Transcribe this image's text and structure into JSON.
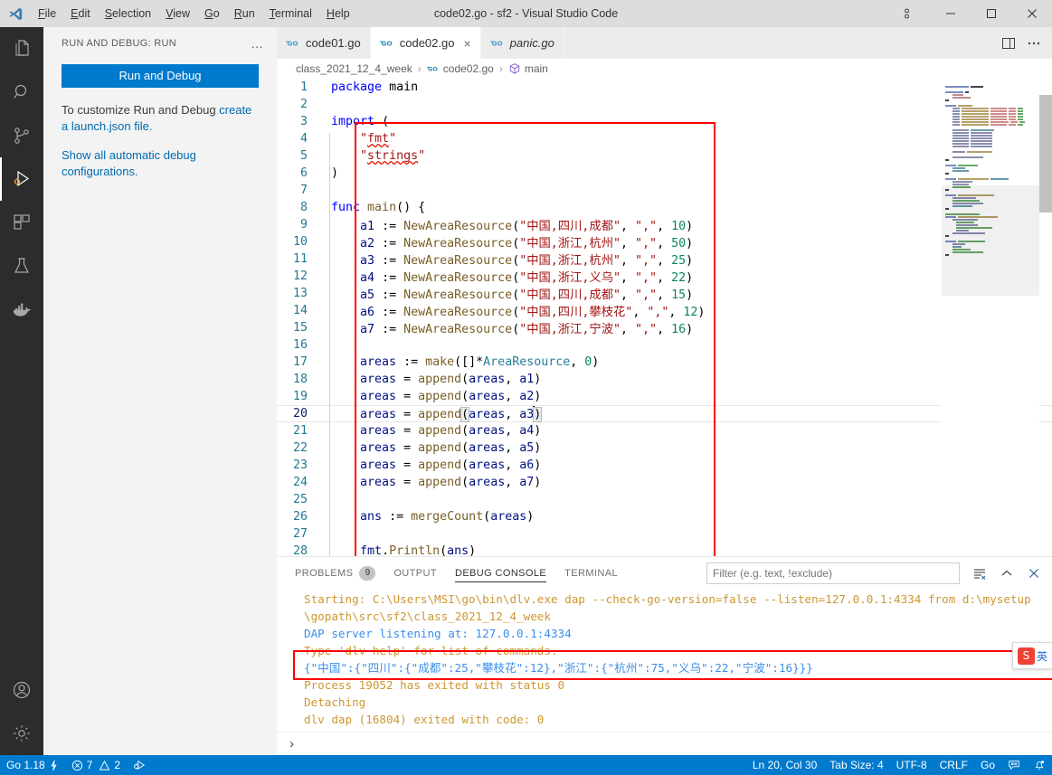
{
  "window": {
    "title": "code02.go - sf2 - Visual Studio Code",
    "menu": [
      "File",
      "Edit",
      "Selection",
      "View",
      "Go",
      "Run",
      "Terminal",
      "Help"
    ],
    "controls": {
      "layout": "editor-layout-icon",
      "minimize": "minimize-icon",
      "maximize": "maximize-icon",
      "close": "close-icon"
    }
  },
  "activitybar": {
    "items": [
      {
        "name": "explorer",
        "icon": "files-icon",
        "active": false
      },
      {
        "name": "search",
        "icon": "search-icon",
        "active": false
      },
      {
        "name": "source-control",
        "icon": "source-control-icon",
        "active": false
      },
      {
        "name": "run-and-debug",
        "icon": "run-debug-icon",
        "active": true
      },
      {
        "name": "extensions",
        "icon": "extensions-icon",
        "active": false
      },
      {
        "name": "testing",
        "icon": "beaker-icon",
        "active": false
      },
      {
        "name": "docker",
        "icon": "docker-icon",
        "active": false
      },
      {
        "name": "accounts",
        "icon": "account-icon",
        "active": false
      },
      {
        "name": "settings",
        "icon": "gear-icon",
        "active": false
      }
    ]
  },
  "sidebar": {
    "header": "RUN AND DEBUG: RUN",
    "more_actions": "…",
    "run_button": "Run and Debug",
    "customize_text_lead": "To customize Run and Debug ",
    "customize_link": "create a launch.json file.",
    "automatic_link": "Show all automatic debug configurations."
  },
  "tabs": [
    {
      "label": "code01.go",
      "icon": "go-file-icon",
      "active": false,
      "preview": false,
      "dirty": false
    },
    {
      "label": "code02.go",
      "icon": "go-file-icon",
      "active": true,
      "preview": false,
      "close": "×"
    },
    {
      "label": "panic.go",
      "icon": "go-file-icon",
      "active": false,
      "preview": true
    }
  ],
  "editor_actions": {
    "split": "split-editor-icon",
    "more": "more-actions-icon"
  },
  "breadcrumb": [
    {
      "label": "class_2021_12_4_week",
      "icon": ""
    },
    {
      "label": "code02.go",
      "icon": "go-file-icon"
    },
    {
      "label": "main",
      "icon": "symbol-method-icon"
    }
  ],
  "breadcrumb_separator": "›",
  "code": {
    "language": "go",
    "lines": [
      {
        "n": 1,
        "text": "package main"
      },
      {
        "n": 2,
        "text": ""
      },
      {
        "n": 3,
        "text": "import ("
      },
      {
        "n": 4,
        "text": "    \"fmt\""
      },
      {
        "n": 5,
        "text": "    \"strings\""
      },
      {
        "n": 6,
        "text": ")"
      },
      {
        "n": 7,
        "text": ""
      },
      {
        "n": 8,
        "text": "func main() {"
      },
      {
        "n": 9,
        "text": "    a1 := NewAreaResource(\"中国,四川,成都\", \",\", 10)"
      },
      {
        "n": 10,
        "text": "    a2 := NewAreaResource(\"中国,浙江,杭州\", \",\", 50)"
      },
      {
        "n": 11,
        "text": "    a3 := NewAreaResource(\"中国,浙江,杭州\", \",\", 25)"
      },
      {
        "n": 12,
        "text": "    a4 := NewAreaResource(\"中国,浙江,义乌\", \",\", 22)"
      },
      {
        "n": 13,
        "text": "    a5 := NewAreaResource(\"中国,四川,成都\", \",\", 15)"
      },
      {
        "n": 14,
        "text": "    a6 := NewAreaResource(\"中国,四川,攀枝花\", \",\", 12)"
      },
      {
        "n": 15,
        "text": "    a7 := NewAreaResource(\"中国,浙江,宁波\", \",\", 16)"
      },
      {
        "n": 16,
        "text": ""
      },
      {
        "n": 17,
        "text": "    areas := make([]*AreaResource, 0)"
      },
      {
        "n": 18,
        "text": "    areas = append(areas, a1)"
      },
      {
        "n": 19,
        "text": "    areas = append(areas, a2)"
      },
      {
        "n": 20,
        "text": "    areas = append(areas, a3)"
      },
      {
        "n": 21,
        "text": "    areas = append(areas, a4)"
      },
      {
        "n": 22,
        "text": "    areas = append(areas, a5)"
      },
      {
        "n": 23,
        "text": "    areas = append(areas, a6)"
      },
      {
        "n": 24,
        "text": "    areas = append(areas, a7)"
      },
      {
        "n": 25,
        "text": ""
      },
      {
        "n": 26,
        "text": "    ans := mergeCount(areas)"
      },
      {
        "n": 27,
        "text": ""
      },
      {
        "n": 28,
        "text": "    fmt.Println(ans)"
      }
    ],
    "current_line": 20,
    "unused_import": "strings"
  },
  "annotation": {
    "color": "#ff0000",
    "code_box_label": "code-highlight-box",
    "console_box_label": "console-highlight-box"
  },
  "panel": {
    "tabs": [
      {
        "label": "PROBLEMS",
        "badge": "9",
        "active": false
      },
      {
        "label": "OUTPUT",
        "badge": "",
        "active": false
      },
      {
        "label": "DEBUG CONSOLE",
        "badge": "",
        "active": true
      },
      {
        "label": "TERMINAL",
        "badge": "",
        "active": false
      }
    ],
    "filter_placeholder": "Filter (e.g. text, !exclude)",
    "filter_value": "",
    "actions": {
      "clear": "clear-console-icon",
      "maximize": "chevron-up-icon",
      "close": "close-panel-icon"
    },
    "console_lines": [
      {
        "text": "Starting: C:\\Users\\MSI\\go\\bin\\dlv.exe dap --check-go-version=false --listen=127.0.0.1:4334 from d:\\mysetup",
        "color": "orange"
      },
      {
        "text": "\\gopath\\src\\sf2\\class_2021_12_4_week",
        "color": "orange"
      },
      {
        "text": "DAP server listening at: 127.0.0.1:4334",
        "color": "blue"
      },
      {
        "text": "Type 'dlv help' for list of commands.",
        "color": "orange"
      },
      {
        "text": "{\"中国\":{\"四川\":{\"成都\":25,\"攀枝花\":12},\"浙江\":{\"杭州\":75,\"义乌\":22,\"宁波\":16}}}",
        "color": "blue"
      },
      {
        "text": "Process 19052 has exited with status 0",
        "color": "orange"
      },
      {
        "text": "Detaching",
        "color": "orange"
      },
      {
        "text": "dlv dap (16804) exited with code: 0",
        "color": "orange"
      }
    ],
    "prompt": "›"
  },
  "statusbar": {
    "left": [
      {
        "name": "go-version",
        "label": "Go 1.18",
        "icon": "lightning-icon"
      },
      {
        "name": "problems",
        "label": "7",
        "label2": "2",
        "icon": "error-icon",
        "icon2": "warning-icon"
      },
      {
        "name": "run-task",
        "label": "",
        "icon": "debug-alt-icon"
      }
    ],
    "right": [
      {
        "name": "cursor-position",
        "label": "Ln 20, Col 30"
      },
      {
        "name": "tab-size",
        "label": "Tab Size: 4"
      },
      {
        "name": "encoding",
        "label": "UTF-8"
      },
      {
        "name": "eol",
        "label": "CRLF"
      },
      {
        "name": "language-mode",
        "label": "Go"
      },
      {
        "name": "feedback",
        "label": "",
        "icon": "feedback-icon"
      },
      {
        "name": "notifications",
        "label": "",
        "icon": "bell-dot-icon"
      }
    ]
  },
  "ime": {
    "logo": "S",
    "mode": "英"
  }
}
